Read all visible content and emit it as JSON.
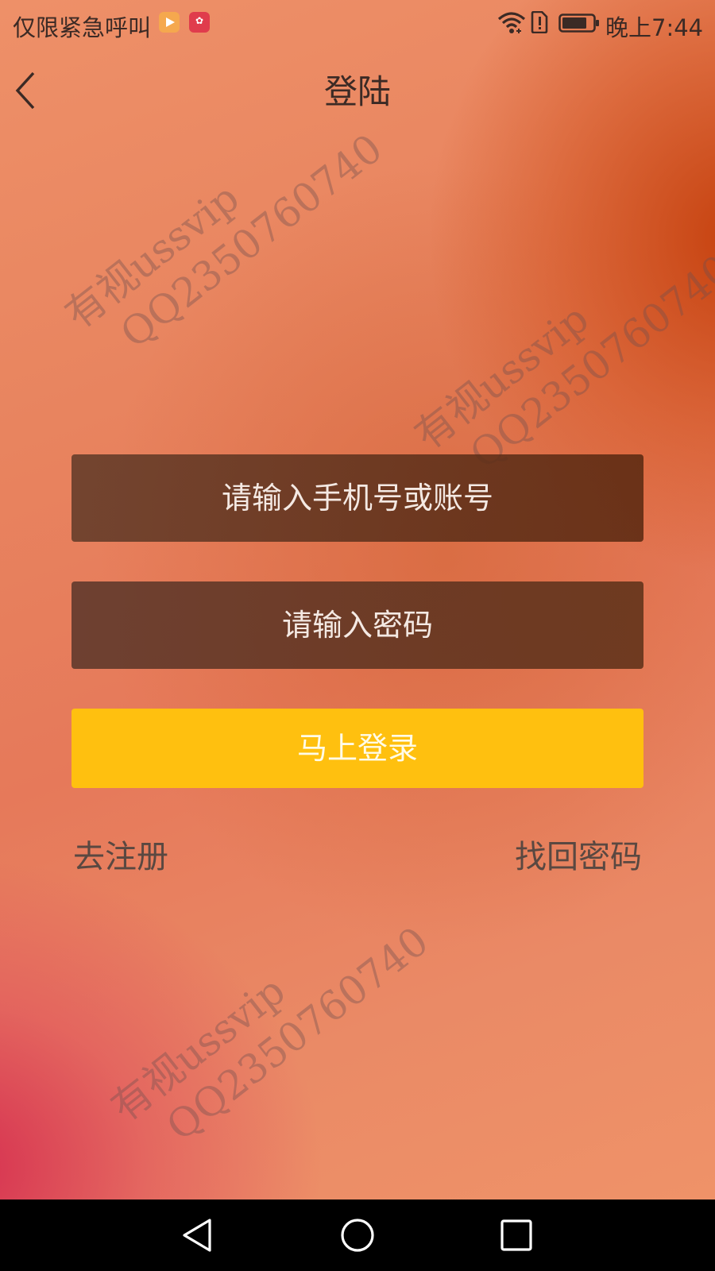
{
  "status_bar": {
    "carrier_text": "仅限紧急呼叫",
    "time": "晚上7:44",
    "icons": [
      "video-app-icon",
      "huawei-app-icon",
      "wifi-icon",
      "sim-alert-icon",
      "battery-icon"
    ]
  },
  "header": {
    "title": "登陆",
    "back_icon": "chevron-left-icon"
  },
  "form": {
    "phone_placeholder": "请输入手机号或账号",
    "password_placeholder": "请输入密码",
    "login_label": "马上登录"
  },
  "links": {
    "register": "去注册",
    "recover_password": "找回密码"
  },
  "watermark": {
    "line1": "有视ussvip",
    "line2": "QQ2350760740"
  },
  "system_nav": {
    "icons": [
      "nav-back-icon",
      "nav-home-icon",
      "nav-recent-icon"
    ]
  },
  "colors": {
    "login_button": "#ffc00f",
    "field_background": "#6a3a22",
    "system_nav_background": "#000000"
  }
}
